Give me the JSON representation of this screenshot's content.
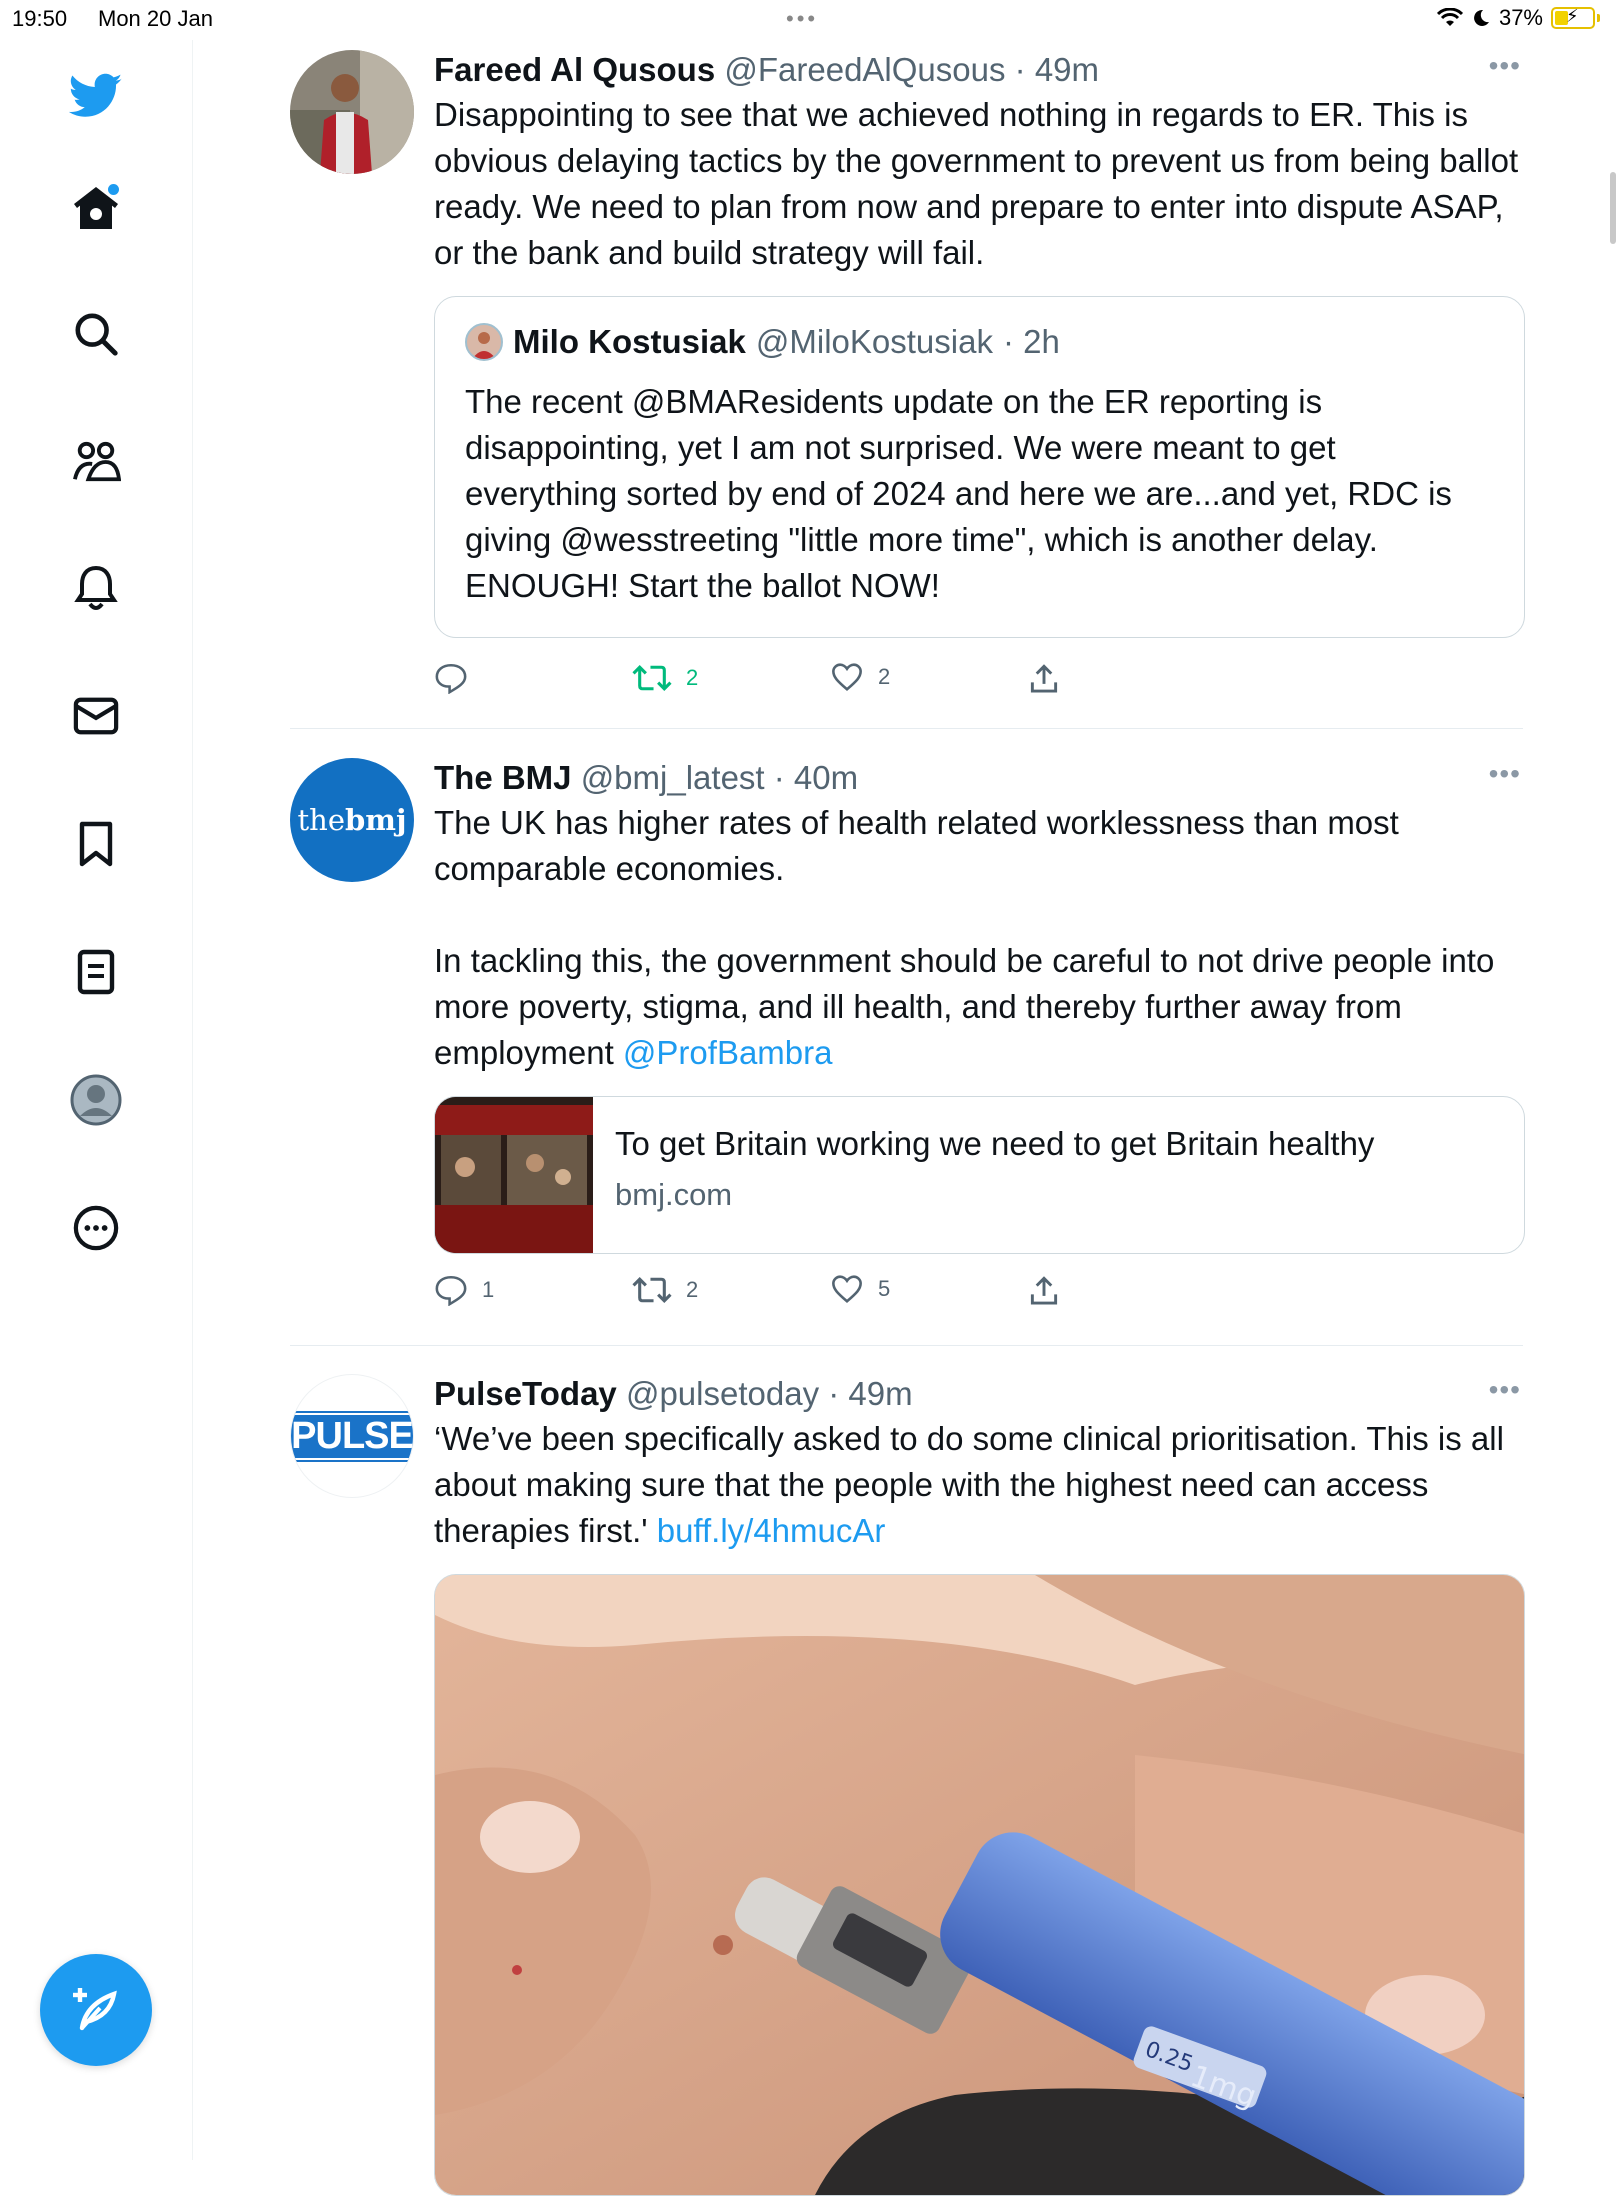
{
  "status_bar": {
    "time": "19:50",
    "date": "Mon 20 Jan",
    "battery_pct": "37%",
    "battery_level": 0.37
  },
  "colors": {
    "accent": "#1d9bf0",
    "retweet_active": "#00ba7c",
    "text_primary": "#0f1419",
    "text_secondary": "#536471"
  },
  "sidebar": {
    "icons": [
      "twitter-logo",
      "home-icon",
      "search-icon",
      "communities-icon",
      "notifications-icon",
      "messages-icon",
      "bookmarks-icon",
      "lists-icon",
      "profile-icon",
      "more-icon"
    ],
    "compose_icon": "compose-icon"
  },
  "tweets": [
    {
      "name": "Fareed Al Qusous",
      "handle": "@FareedAlQusous",
      "time": "· 49m",
      "text": "Disappointing to see that we achieved nothing in regards to ER. This is obvious delaying tactics by the government to prevent us from being ballot ready. We need to plan from now and prepare to enter into dispute ASAP, or the bank and build strategy will fail.",
      "quote": {
        "name": "Milo Kostusiak",
        "handle": "@MiloKostusiak",
        "time": "· 2h",
        "text": "The recent @BMAResidents update on the ER reporting is disappointing, yet I am not surprised. We were meant to get everything sorted by end of 2024 and here we are...and yet, RDC is giving @wesstreeting \"little more time\", which is another delay. ENOUGH! Start the ballot NOW!"
      },
      "replies": "",
      "retweets": "2",
      "likes": "2"
    },
    {
      "name": "The BMJ",
      "handle": "@bmj_latest",
      "time": "· 40m",
      "avatar_text_a": "the",
      "avatar_text_b": "bmj",
      "text": "The UK has higher rates of health related worklessness than most comparable economies.\n\nIn tackling this, the government should be careful to not drive people into more poverty, stigma, and ill health, and thereby further away from employment ",
      "mention": "@ProfBambra",
      "card": {
        "title": "To get Britain working we need to get Britain healthy",
        "domain": "bmj.com"
      },
      "replies": "1",
      "retweets": "2",
      "likes": "5"
    },
    {
      "name": "PulseToday",
      "handle": "@pulsetoday",
      "time": "· 49m",
      "avatar_text": "PULSE",
      "text": "‘We’ve been specifically asked to do some clinical prioritisation. This is all about making sure that the people with the highest need can access therapies first.' ",
      "link": "buff.ly/4hmucAr",
      "media_label": "0.25",
      "media_label_b": "1mg"
    }
  ]
}
